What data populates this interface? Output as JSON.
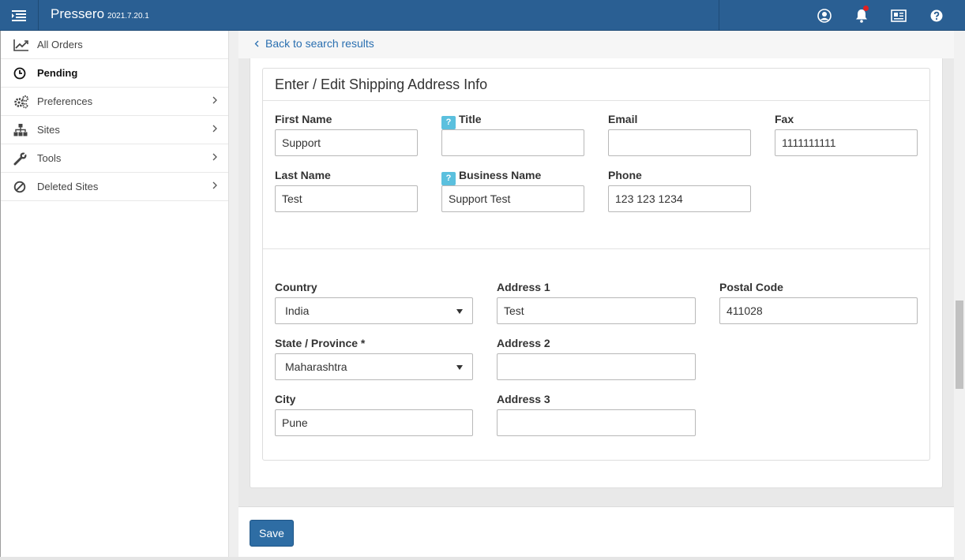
{
  "header": {
    "app_name": "Pressero",
    "version": "2021.7.20.1",
    "icons": [
      "menu-icon",
      "user-icon",
      "bell-icon",
      "news-icon",
      "help-icon"
    ],
    "brand_color": "#2a5f93"
  },
  "sidebar": {
    "items": [
      {
        "label": "All Orders",
        "icon": "chart-line-icon",
        "active": false,
        "has_children": false
      },
      {
        "label": "Pending",
        "icon": "clock-icon",
        "active": true,
        "has_children": false
      },
      {
        "label": "Preferences",
        "icon": "gears-icon",
        "active": false,
        "has_children": true
      },
      {
        "label": "Sites",
        "icon": "sitemap-icon",
        "active": false,
        "has_children": true
      },
      {
        "label": "Tools",
        "icon": "wrench-icon",
        "active": false,
        "has_children": true
      },
      {
        "label": "Deleted Sites",
        "icon": "ban-icon",
        "active": false,
        "has_children": true
      }
    ]
  },
  "back_link": "Back to search results",
  "form": {
    "title": "Enter / Edit Shipping Address Info",
    "first_name": {
      "label": "First Name",
      "value": "Support"
    },
    "title_field": {
      "label": "Title",
      "value": ""
    },
    "email": {
      "label": "Email",
      "value": ""
    },
    "fax": {
      "label": "Fax",
      "value": "1111111111"
    },
    "last_name": {
      "label": "Last Name",
      "value": "Test"
    },
    "business_name": {
      "label": "Business Name",
      "value": "Support Test"
    },
    "phone": {
      "label": "Phone",
      "value": "123 123 1234"
    },
    "country": {
      "label": "Country",
      "value": "India"
    },
    "address1": {
      "label": "Address 1",
      "value": "Test"
    },
    "postal_code": {
      "label": "Postal Code",
      "value": "411028"
    },
    "state": {
      "label": "State / Province *",
      "value": "Maharashtra"
    },
    "address2": {
      "label": "Address 2",
      "value": ""
    },
    "city": {
      "label": "City",
      "value": "Pune"
    },
    "address3": {
      "label": "Address 3",
      "value": ""
    },
    "help_glyph": "?"
  },
  "footer": {
    "save_label": "Save"
  }
}
